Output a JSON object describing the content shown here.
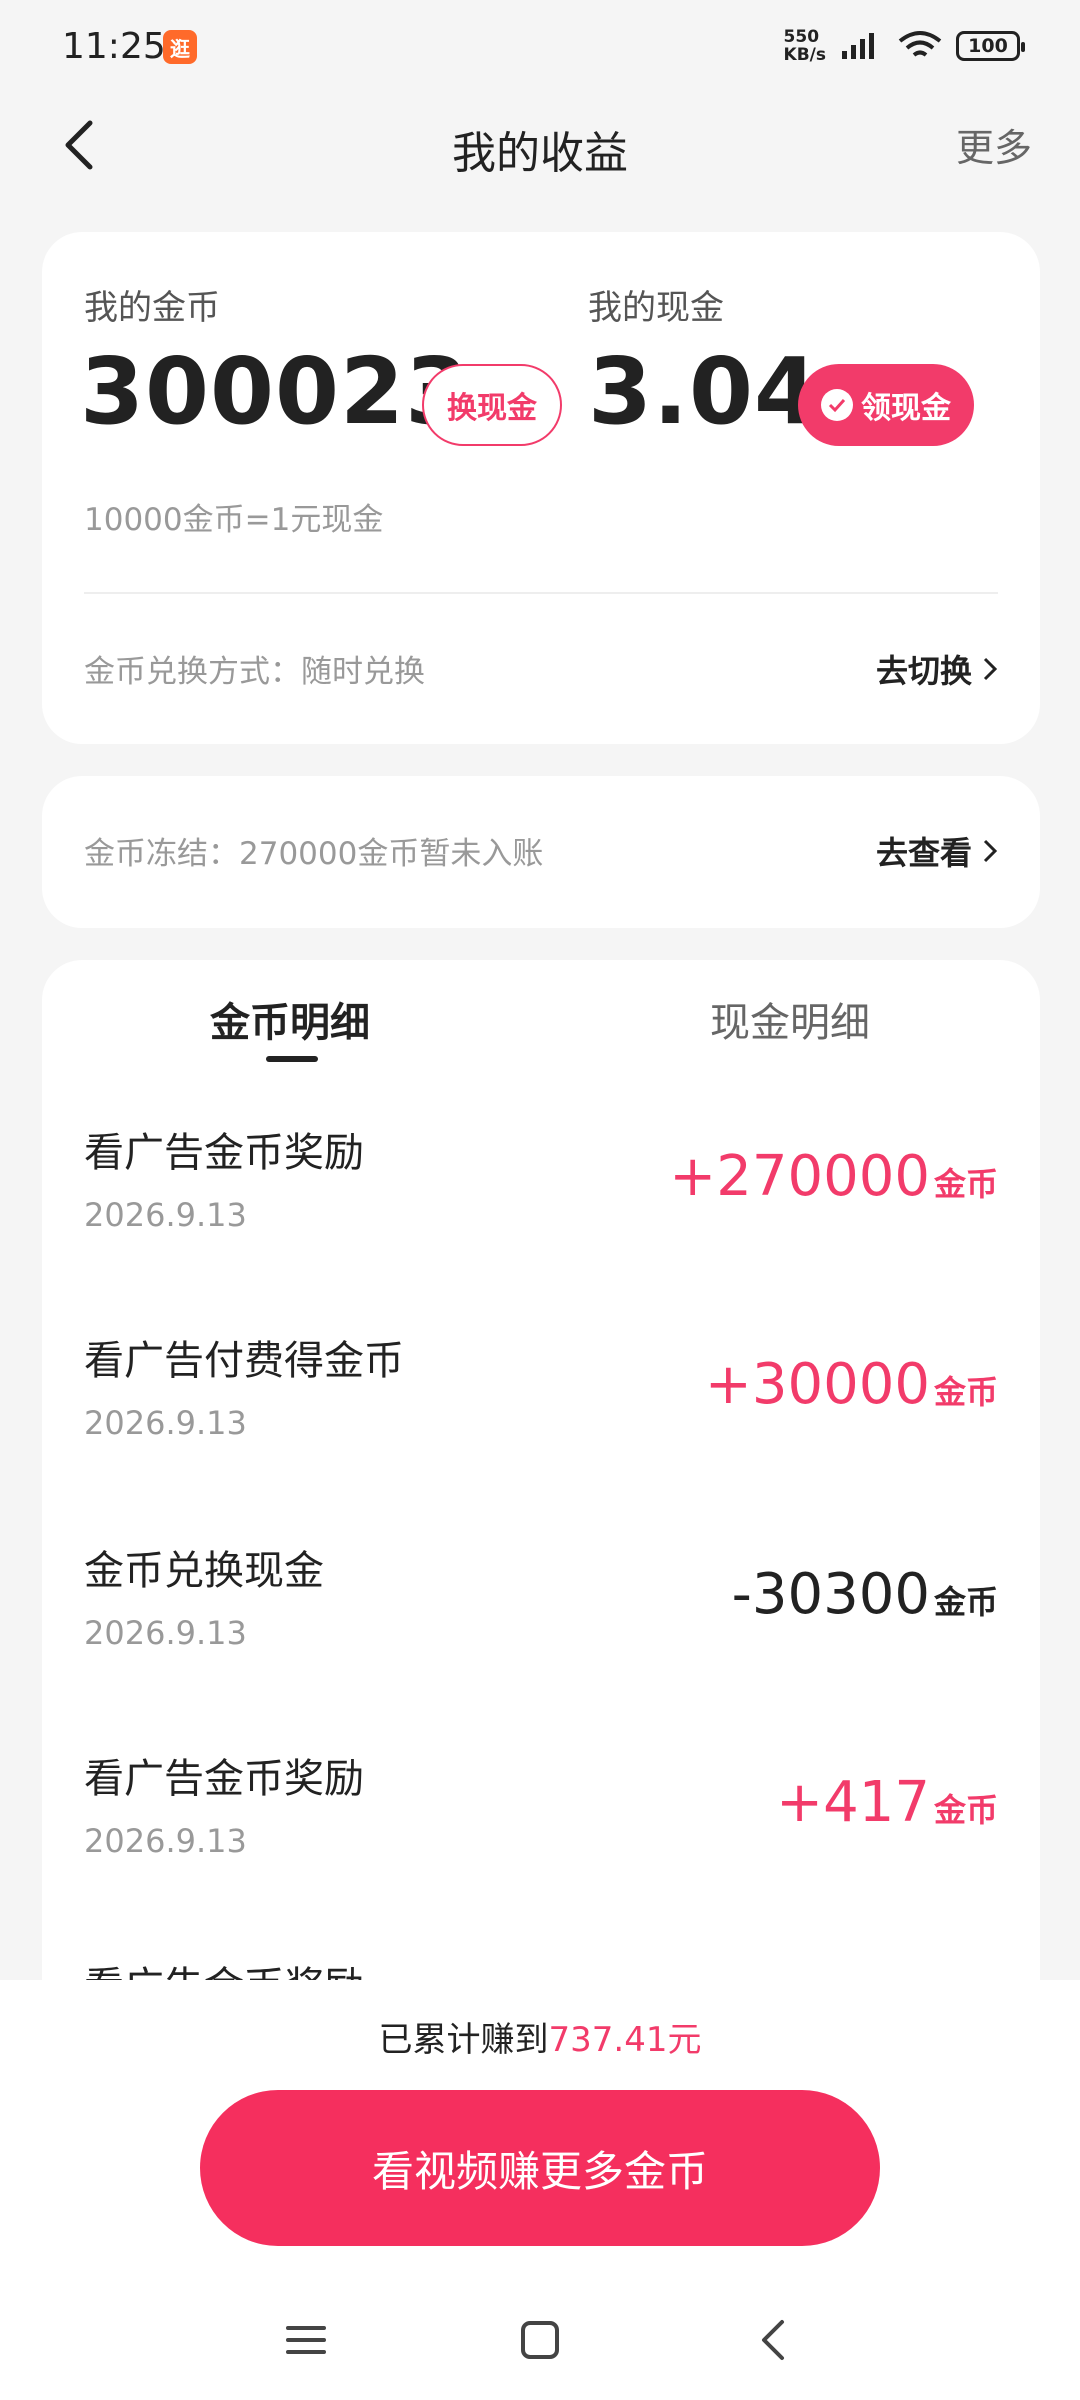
{
  "status": {
    "time": "11:25",
    "app_badge": "逛",
    "net_speed_top": "550",
    "net_speed_bottom": "KB/s",
    "battery": "100"
  },
  "header": {
    "title": "我的收益",
    "more": "更多"
  },
  "coins": {
    "coin_label": "我的金币",
    "coin_value": "300023",
    "exchange_btn": "换现金",
    "cash_label": "我的现金",
    "cash_value": "3.04",
    "withdraw_btn": "领现金",
    "rate": "10000金币=1元现金",
    "method_text": "金币兑换方式：随时兑换",
    "method_link": "去切换"
  },
  "frozen": {
    "text": "金币冻结：270000金币暂未入账",
    "link": "去查看"
  },
  "tabs": [
    {
      "label": "金币明细"
    },
    {
      "label": "现金明细"
    }
  ],
  "transactions": [
    {
      "title": "看广告金币奖励",
      "date": "2026.9.13",
      "amount": "+270000",
      "unit": "金币"
    },
    {
      "title": "看广告付费得金币",
      "date": "2026.9.13",
      "amount": "+30000",
      "unit": "金币"
    },
    {
      "title": "金币兑换现金",
      "date": "2026.9.13",
      "amount": "-30300",
      "unit": "金币"
    },
    {
      "title": "看广告金币奖励",
      "date": "2026.9.13",
      "amount": "+417",
      "unit": "金币"
    },
    {
      "title": "看广告金币奖励",
      "date": "",
      "amount": "",
      "unit": ""
    }
  ],
  "footer": {
    "earned_prefix": "已累计赚到",
    "earned_amount": "737.41元",
    "cta": "看视频赚更多金币"
  },
  "colors": {
    "accent": "#f23b6a",
    "cta": "#f52f5e",
    "background": "#f5f5f5"
  }
}
